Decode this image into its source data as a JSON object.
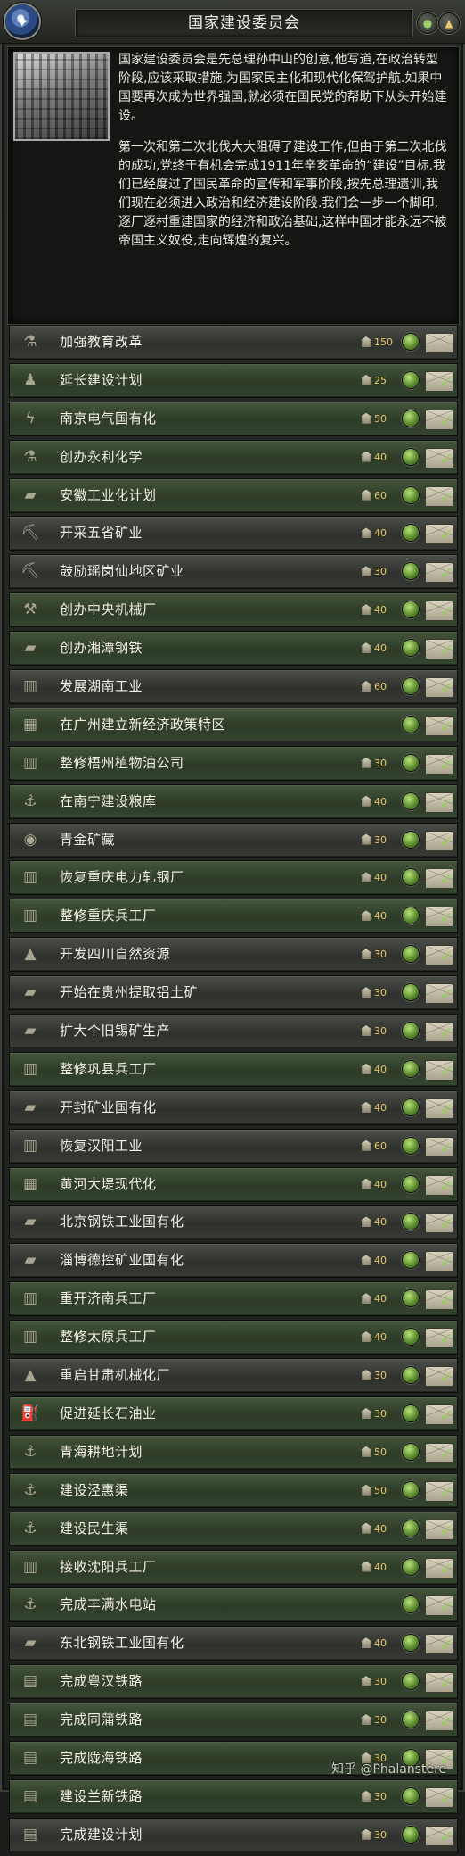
{
  "header": {
    "title": "国家建设委员会",
    "minimize_glyph": "▲"
  },
  "description": {
    "paragraph_1": "国家建设委员会是先总理孙中山的创意,他写道,在政治转型阶段,应该采取措施,为国家民主化和现代化保驾护航.如果中国要再次成为世界强国,就必须在国民党的帮助下从头开始建设。",
    "paragraph_2": "第一次和第二次北伐大大阻碍了建设工作,但由于第二次北伐的成功,党终于有机会完成1911年辛亥革命的“建设”目标.我们已经度过了国民革命的宣传和军事阶段,按先总理遗训,我们现在必须进入政治和经济建设阶段.我们会一步一个脚印,逐厂逐村重建国家的经济和政治基础,这样中国才能永远不被帝国主义奴役,走向辉煌的复兴。"
  },
  "focus_items": [
    {
      "label": "加强教育改革",
      "cost": "150",
      "style": "dark",
      "icon": "flask-icon",
      "glyph": "⚗",
      "check": false
    },
    {
      "label": "延长建设计划",
      "cost": "25",
      "style": "green",
      "icon": "people-icon",
      "glyph": "♟",
      "check": true
    },
    {
      "label": "南京电气国有化",
      "cost": "50",
      "style": "green",
      "icon": "lightning-icon",
      "glyph": "ϟ",
      "check": true
    },
    {
      "label": "创办永利化学",
      "cost": "40",
      "style": "green",
      "icon": "flask-icon",
      "glyph": "⚗",
      "check": true
    },
    {
      "label": "安徽工业化计划",
      "cost": "60",
      "style": "green",
      "icon": "factory-icon",
      "glyph": "▰",
      "check": true
    },
    {
      "label": "开采五省矿业",
      "cost": "40",
      "style": "dark",
      "icon": "pickaxe-icon",
      "glyph": "⛏",
      "check": true
    },
    {
      "label": "鼓励瑶岗仙地区矿业",
      "cost": "30",
      "style": "dark",
      "icon": "pickaxe-icon",
      "glyph": "⛏",
      "check": true
    },
    {
      "label": "创办中央机械厂",
      "cost": "40",
      "style": "green",
      "icon": "wrench-icon",
      "glyph": "⚒",
      "check": true
    },
    {
      "label": "创办湘潭钢铁",
      "cost": "40",
      "style": "green",
      "icon": "ingot-icon",
      "glyph": "▰",
      "check": true
    },
    {
      "label": "发展湖南工业",
      "cost": "60",
      "style": "dark",
      "icon": "factory-icon",
      "glyph": "▥",
      "check": true
    },
    {
      "label": "在广州建立新经济政策特区",
      "cost": "",
      "style": "green",
      "icon": "building-icon",
      "glyph": "▦",
      "check": true
    },
    {
      "label": "整修梧州植物油公司",
      "cost": "30",
      "style": "green",
      "icon": "factory-icon",
      "glyph": "▥",
      "check": true
    },
    {
      "label": "在南宁建设粮库",
      "cost": "40",
      "style": "green",
      "icon": "crane-icon",
      "glyph": "⚓",
      "check": true
    },
    {
      "label": "青金矿藏",
      "cost": "30",
      "style": "dark",
      "icon": "ore-icon",
      "glyph": "◉",
      "check": true
    },
    {
      "label": "恢复重庆电力轧钢厂",
      "cost": "40",
      "style": "green",
      "icon": "factory-icon",
      "glyph": "▥",
      "check": true
    },
    {
      "label": "整修重庆兵工厂",
      "cost": "40",
      "style": "green",
      "icon": "factory-icon",
      "glyph": "▥",
      "check": true
    },
    {
      "label": "开发四川自然资源",
      "cost": "30",
      "style": "dark",
      "icon": "oil-drop-icon",
      "glyph": "▲",
      "check": true
    },
    {
      "label": "开始在贵州提取铝土矿",
      "cost": "30",
      "style": "dark",
      "icon": "ingot-icon",
      "glyph": "▰",
      "check": true
    },
    {
      "label": "扩大个旧锡矿生产",
      "cost": "30",
      "style": "dark",
      "icon": "ingot-icon",
      "glyph": "▰",
      "check": true
    },
    {
      "label": "整修巩县兵工厂",
      "cost": "40",
      "style": "green",
      "icon": "factory-icon",
      "glyph": "▥",
      "check": true
    },
    {
      "label": "开封矿业国有化",
      "cost": "40",
      "style": "dark",
      "icon": "ingot-icon",
      "glyph": "▰",
      "check": true
    },
    {
      "label": "恢复汉阳工业",
      "cost": "60",
      "style": "dark",
      "icon": "factory-icon",
      "glyph": "▥",
      "check": true
    },
    {
      "label": "黄河大堤现代化",
      "cost": "40",
      "style": "green",
      "icon": "building-icon",
      "glyph": "▦",
      "check": true
    },
    {
      "label": "北京钢铁工业国有化",
      "cost": "40",
      "style": "dark",
      "icon": "ingot-icon",
      "glyph": "▰",
      "check": true
    },
    {
      "label": "淄博德控矿业国有化",
      "cost": "40",
      "style": "dark",
      "icon": "ingot-icon",
      "glyph": "▰",
      "check": true
    },
    {
      "label": "重开济南兵工厂",
      "cost": "40",
      "style": "green",
      "icon": "factory-icon",
      "glyph": "▥",
      "check": true
    },
    {
      "label": "整修太原兵工厂",
      "cost": "40",
      "style": "green",
      "icon": "factory-icon",
      "glyph": "▥",
      "check": true
    },
    {
      "label": "重启甘肃机械化厂",
      "cost": "30",
      "style": "dark",
      "icon": "oil-drop-icon",
      "glyph": "▲",
      "check": true
    },
    {
      "label": "促进延长石油业",
      "cost": "30",
      "style": "green",
      "icon": "oil-derrick-icon",
      "glyph": "⛽",
      "check": true
    },
    {
      "label": "青海耕地计划",
      "cost": "50",
      "style": "green",
      "icon": "crane-icon",
      "glyph": "⚓",
      "check": true
    },
    {
      "label": "建设泾惠渠",
      "cost": "50",
      "style": "green",
      "icon": "crane-icon",
      "glyph": "⚓",
      "check": true
    },
    {
      "label": "建设民生渠",
      "cost": "40",
      "style": "green",
      "icon": "crane-icon",
      "glyph": "⚓",
      "check": true
    },
    {
      "label": "接收沈阳兵工厂",
      "cost": "40",
      "style": "green",
      "icon": "factory-icon",
      "glyph": "▥",
      "check": true
    },
    {
      "label": "完成丰满水电站",
      "cost": "",
      "style": "green",
      "icon": "crane-icon",
      "glyph": "⚓",
      "check": true
    },
    {
      "label": "东北钢铁工业国有化",
      "cost": "40",
      "style": "dark",
      "icon": "ingot-icon",
      "glyph": "▰",
      "check": true
    },
    {
      "label": "完成粤汉铁路",
      "cost": "30",
      "style": "green",
      "icon": "railway-icon",
      "glyph": "▤",
      "check": true
    },
    {
      "label": "完成同蒲铁路",
      "cost": "30",
      "style": "green",
      "icon": "railway-icon",
      "glyph": "▤",
      "check": true
    },
    {
      "label": "完成陇海铁路",
      "cost": "30",
      "style": "green",
      "icon": "railway-icon",
      "glyph": "▤",
      "check": true
    },
    {
      "label": "建设兰新铁路",
      "cost": "30",
      "style": "green",
      "icon": "railway-icon",
      "glyph": "▤",
      "check": true
    },
    {
      "label": "完成建设计划",
      "cost": "30",
      "style": "dark",
      "icon": "railway-icon",
      "glyph": "▤",
      "check": true
    }
  ],
  "watermark": "知乎 @Phalanstère"
}
